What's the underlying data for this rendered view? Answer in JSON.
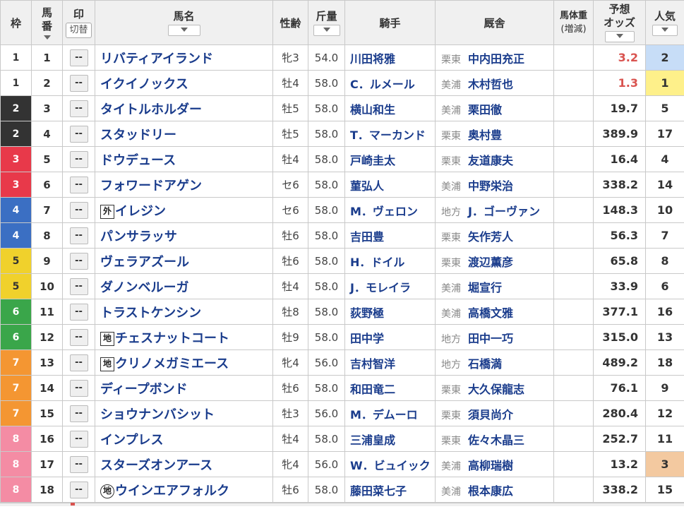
{
  "header": {
    "waku": "枠",
    "umaban_line1": "馬",
    "umaban_line2": "番",
    "mark_label": "印",
    "mark_toggle": "切替",
    "name": "馬名",
    "sex_age": "性齢",
    "weight": "斤量",
    "jockey": "騎手",
    "trainer": "厩舎",
    "body_weight_line1": "馬体重",
    "body_weight_line2": "(増減)",
    "odds_line1": "予想",
    "odds_line2": "オッズ",
    "pop": "人気",
    "sort_glyph": "⌄"
  },
  "colors": {
    "waku_1": "#ffffff",
    "waku_2": "#333333",
    "waku_3": "#e8394a",
    "waku_4": "#3b6fc3",
    "waku_5": "#f0d12c",
    "waku_6": "#3aa64a",
    "waku_7": "#f49632",
    "waku_8": "#f48ca4",
    "link": "#1a3c8c",
    "hot_odds": "#d9534f"
  },
  "mark_default": "--",
  "rows": [
    {
      "waku": "1",
      "num": "1",
      "tag": "",
      "name": "リバティアイランド",
      "sex": "牝3",
      "wt": "54.0",
      "jockey": "川田将雅",
      "area": "栗東",
      "trainer": "中内田充正",
      "bw": "",
      "odds": "3.2",
      "hot": true,
      "pop": "2"
    },
    {
      "waku": "1",
      "num": "2",
      "tag": "",
      "name": "イクイノックス",
      "sex": "牡4",
      "wt": "58.0",
      "jockey": "C．ルメール",
      "area": "美浦",
      "trainer": "木村哲也",
      "bw": "",
      "odds": "1.3",
      "hot": true,
      "pop": "1"
    },
    {
      "waku": "2",
      "num": "3",
      "tag": "",
      "name": "タイトルホルダー",
      "sex": "牡5",
      "wt": "58.0",
      "jockey": "横山和生",
      "area": "美浦",
      "trainer": "栗田徹",
      "bw": "",
      "odds": "19.7",
      "hot": false,
      "pop": "5"
    },
    {
      "waku": "2",
      "num": "4",
      "tag": "",
      "name": "スタッドリー",
      "sex": "牡5",
      "wt": "58.0",
      "jockey": "T．マーカンド",
      "area": "栗東",
      "trainer": "奥村豊",
      "bw": "",
      "odds": "389.9",
      "hot": false,
      "pop": "17"
    },
    {
      "waku": "3",
      "num": "5",
      "tag": "",
      "name": "ドウデュース",
      "sex": "牡4",
      "wt": "58.0",
      "jockey": "戸崎圭太",
      "area": "栗東",
      "trainer": "友道康夫",
      "bw": "",
      "odds": "16.4",
      "hot": false,
      "pop": "4"
    },
    {
      "waku": "3",
      "num": "6",
      "tag": "",
      "name": "フォワードアゲン",
      "sex": "セ6",
      "wt": "58.0",
      "jockey": "菫弘人",
      "area": "美浦",
      "trainer": "中野栄治",
      "bw": "",
      "odds": "338.2",
      "hot": false,
      "pop": "14"
    },
    {
      "waku": "4",
      "num": "7",
      "tag": "外",
      "name": "イレジン",
      "sex": "セ6",
      "wt": "58.0",
      "jockey": "M．ヴェロン",
      "area": "地方",
      "trainer": "J．ゴーヴァン",
      "bw": "",
      "odds": "148.3",
      "hot": false,
      "pop": "10"
    },
    {
      "waku": "4",
      "num": "8",
      "tag": "",
      "name": "パンサラッサ",
      "sex": "牡6",
      "wt": "58.0",
      "jockey": "吉田豊",
      "area": "栗東",
      "trainer": "矢作芳人",
      "bw": "",
      "odds": "56.3",
      "hot": false,
      "pop": "7"
    },
    {
      "waku": "5",
      "num": "9",
      "tag": "",
      "name": "ヴェラアズール",
      "sex": "牡6",
      "wt": "58.0",
      "jockey": "H．ドイル",
      "area": "栗東",
      "trainer": "渡辺薫彦",
      "bw": "",
      "odds": "65.8",
      "hot": false,
      "pop": "8"
    },
    {
      "waku": "5",
      "num": "10",
      "tag": "",
      "name": "ダノンベルーガ",
      "sex": "牡4",
      "wt": "58.0",
      "jockey": "J．モレイラ",
      "area": "美浦",
      "trainer": "堀宣行",
      "bw": "",
      "odds": "33.9",
      "hot": false,
      "pop": "6"
    },
    {
      "waku": "6",
      "num": "11",
      "tag": "",
      "name": "トラストケンシン",
      "sex": "牡8",
      "wt": "58.0",
      "jockey": "荻野極",
      "area": "美浦",
      "trainer": "高橋文雅",
      "bw": "",
      "odds": "377.1",
      "hot": false,
      "pop": "16"
    },
    {
      "waku": "6",
      "num": "12",
      "tag": "地",
      "name": "チェスナットコート",
      "sex": "牡9",
      "wt": "58.0",
      "jockey": "田中学",
      "area": "地方",
      "trainer": "田中一巧",
      "bw": "",
      "odds": "315.0",
      "hot": false,
      "pop": "13"
    },
    {
      "waku": "7",
      "num": "13",
      "tag": "地",
      "name": "クリノメガミエース",
      "sex": "牝4",
      "wt": "56.0",
      "jockey": "吉村智洋",
      "area": "地方",
      "trainer": "石橋満",
      "bw": "",
      "odds": "489.2",
      "hot": false,
      "pop": "18"
    },
    {
      "waku": "7",
      "num": "14",
      "tag": "",
      "name": "ディープボンド",
      "sex": "牡6",
      "wt": "58.0",
      "jockey": "和田竜二",
      "area": "栗東",
      "trainer": "大久保龍志",
      "bw": "",
      "odds": "76.1",
      "hot": false,
      "pop": "9"
    },
    {
      "waku": "7",
      "num": "15",
      "tag": "",
      "name": "ショウナンバシット",
      "sex": "牡3",
      "wt": "56.0",
      "jockey": "M．デムーロ",
      "area": "栗東",
      "trainer": "須貝尚介",
      "bw": "",
      "odds": "280.4",
      "hot": false,
      "pop": "12"
    },
    {
      "waku": "8",
      "num": "16",
      "tag": "",
      "name": "インプレス",
      "sex": "牡4",
      "wt": "58.0",
      "jockey": "三浦皇成",
      "area": "栗東",
      "trainer": "佐々木晶三",
      "bw": "",
      "odds": "252.7",
      "hot": false,
      "pop": "11"
    },
    {
      "waku": "8",
      "num": "17",
      "tag": "",
      "name": "スターズオンアース",
      "sex": "牝4",
      "wt": "56.0",
      "jockey": "W．ビュイック",
      "area": "美浦",
      "trainer": "高柳瑞樹",
      "bw": "",
      "odds": "13.2",
      "hot": false,
      "pop": "3"
    },
    {
      "waku": "8",
      "num": "18",
      "tag": "㊞",
      "name": "ウインエアフォルク",
      "sex": "牡6",
      "wt": "58.0",
      "jockey": "藤田菜七子",
      "area": "美浦",
      "trainer": "根本康広",
      "bw": "",
      "odds": "338.2",
      "hot": false,
      "pop": "15"
    }
  ]
}
